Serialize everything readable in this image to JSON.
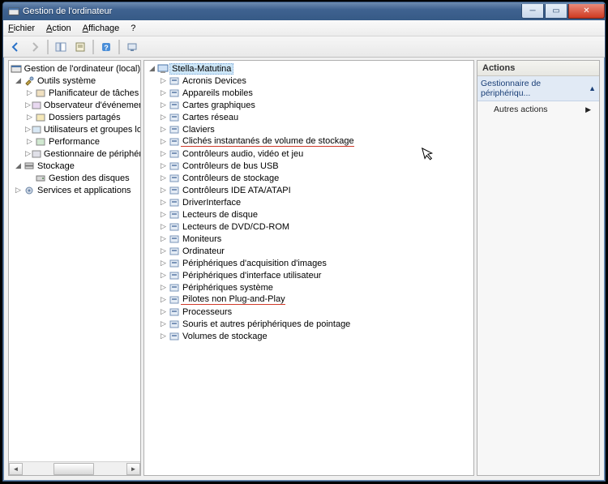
{
  "window": {
    "title": "Gestion de l'ordinateur"
  },
  "menu": {
    "file": "Fichier",
    "action": "Action",
    "view": "Affichage",
    "help": "?"
  },
  "left_tree": {
    "root": "Gestion de l'ordinateur (local)",
    "sys_tools": "Outils système",
    "sys_children": [
      "Planificateur de tâches",
      "Observateur d'événements",
      "Dossiers partagés",
      "Utilisateurs et groupes locaux",
      "Performance",
      "Gestionnaire de périphériques"
    ],
    "storage": "Stockage",
    "storage_children": [
      "Gestion des disques"
    ],
    "services": "Services et applications"
  },
  "mid_tree": {
    "root": "Stella-Matutina",
    "items": [
      "Acronis Devices",
      "Appareils mobiles",
      "Cartes graphiques",
      "Cartes réseau",
      "Claviers",
      "Clichés instantanés de volume de stockage",
      "Contrôleurs audio, vidéo et jeu",
      "Contrôleurs de bus USB",
      "Contrôleurs de stockage",
      "Contrôleurs IDE ATA/ATAPI",
      "DriverInterface",
      "Lecteurs de disque",
      "Lecteurs de DVD/CD-ROM",
      "Moniteurs",
      "Ordinateur",
      "Périphériques d'acquisition d'images",
      "Périphériques d'interface utilisateur",
      "Périphériques système",
      "Pilotes non Plug-and-Play",
      "Processeurs",
      "Souris et autres périphériques de pointage",
      "Volumes de stockage"
    ],
    "underlined": [
      5,
      18
    ]
  },
  "actions": {
    "header": "Actions",
    "sub": "Gestionnaire de périphériqu...",
    "item": "Autres actions"
  }
}
